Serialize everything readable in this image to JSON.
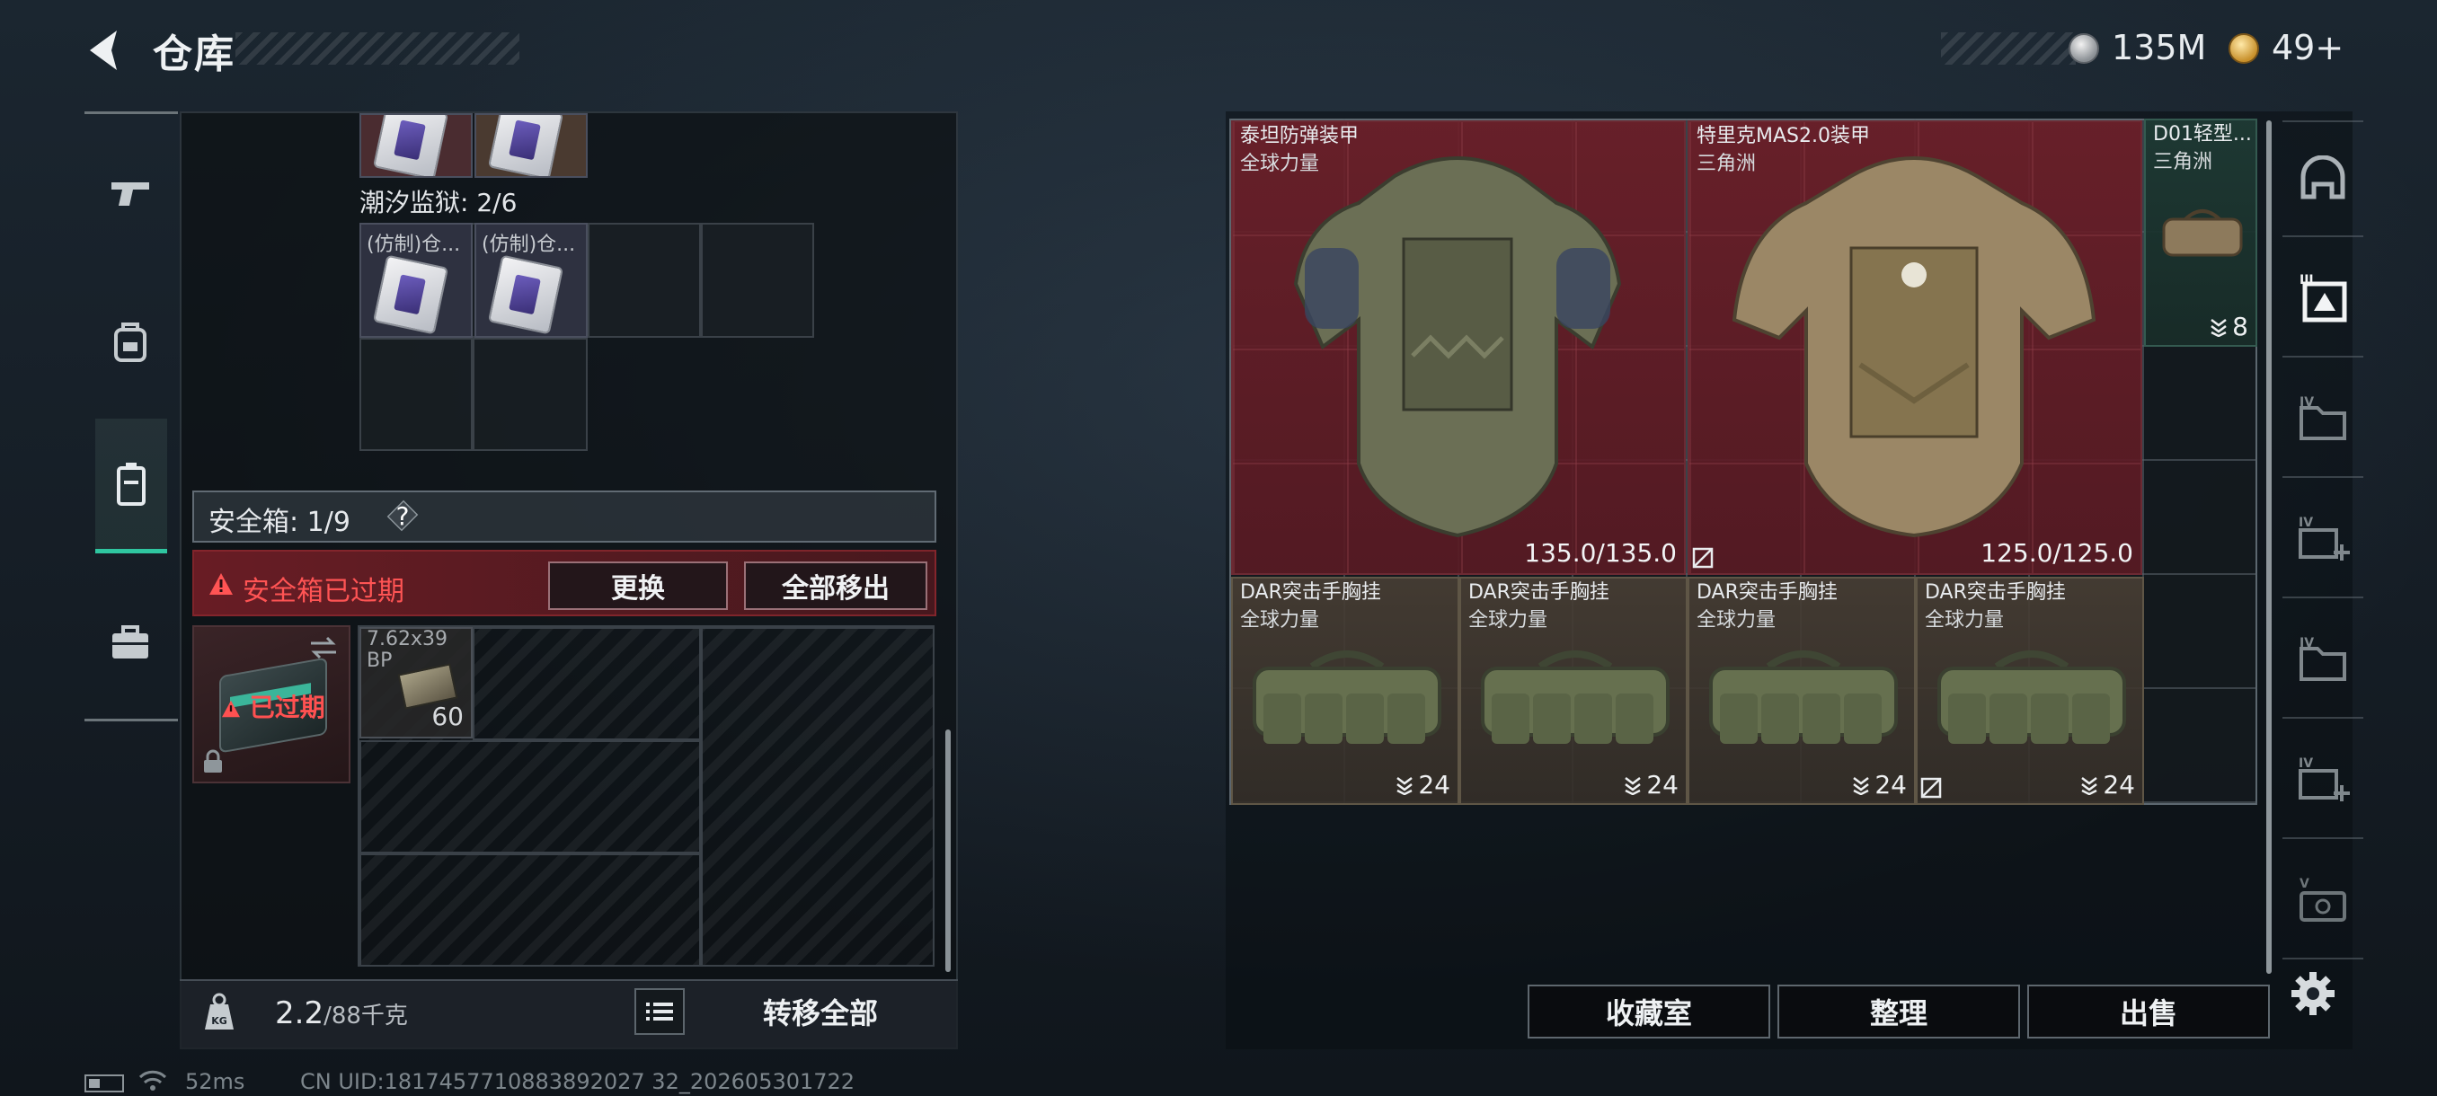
{
  "header": {
    "title": "仓库",
    "currency": [
      {
        "icon": "silver-coin-icon",
        "amount": "135M"
      },
      {
        "icon": "gold-coin-icon",
        "amount": "49+"
      }
    ]
  },
  "left_nav": [
    "pistol-icon",
    "backpack-icon",
    "safe-box-icon",
    "toolbox-icon"
  ],
  "stash": {
    "section_label": "潮汐监狱: 2/6",
    "items": [
      {
        "name": "(仿制)仓..."
      },
      {
        "name": "(仿制)仓..."
      }
    ]
  },
  "safe_box": {
    "label": "安全箱: 1/9",
    "help": "?",
    "expired_warning": "安全箱已过期",
    "replace_button": "更换",
    "move_all_button": "全部移出",
    "expired_overlay": "已过期",
    "ammo": {
      "name": "7.62x39",
      "name_line2": "BP",
      "count": "60"
    }
  },
  "footer": {
    "weight_value": "2.2",
    "weight_max": "/88千克",
    "transfer_all": "转移全部"
  },
  "status_bar": {
    "ping": "52ms",
    "uid": "CN UID:1817457710883892027 32_202605301722"
  },
  "inventory": {
    "armors": [
      {
        "name": "泰坦防弹装甲",
        "source": "全球力量",
        "durability": "135.0/135.0"
      },
      {
        "name": "特里克MAS2.0装甲",
        "source": "三角洲",
        "durability": "125.0/125.0"
      }
    ],
    "d01": {
      "name": "D01轻型...",
      "source": "三角洲",
      "count": "8"
    },
    "rigs": [
      {
        "name": "DAR突击手胸挂",
        "source": "全球力量",
        "count": "24",
        "icon": "stack-icon"
      },
      {
        "name": "DAR突击手胸挂",
        "source": "全球力量",
        "count": "24",
        "icon": "stack-icon"
      },
      {
        "name": "DAR突击手胸挂",
        "source": "全球力量",
        "count": "24",
        "icon": "stack-icon"
      },
      {
        "name": "DAR突击手胸挂",
        "source": "全球力量",
        "count": "24",
        "icon": "no-insure-icon"
      }
    ]
  },
  "side_tabs": [
    "helmet-tab-icon",
    "gallery-tab-icon",
    "folder-IV-icon",
    "add-IV-icon",
    "folder-IV-2-icon",
    "add-IV-2-icon",
    "case-V-icon"
  ],
  "bottom_buttons": {
    "collection": "收藏室",
    "sort": "整理",
    "sell": "出售"
  },
  "colors": {
    "accent_green": "#2fc6a0",
    "warning_red": "#ff5454",
    "armor_bg": "#6e202a"
  }
}
